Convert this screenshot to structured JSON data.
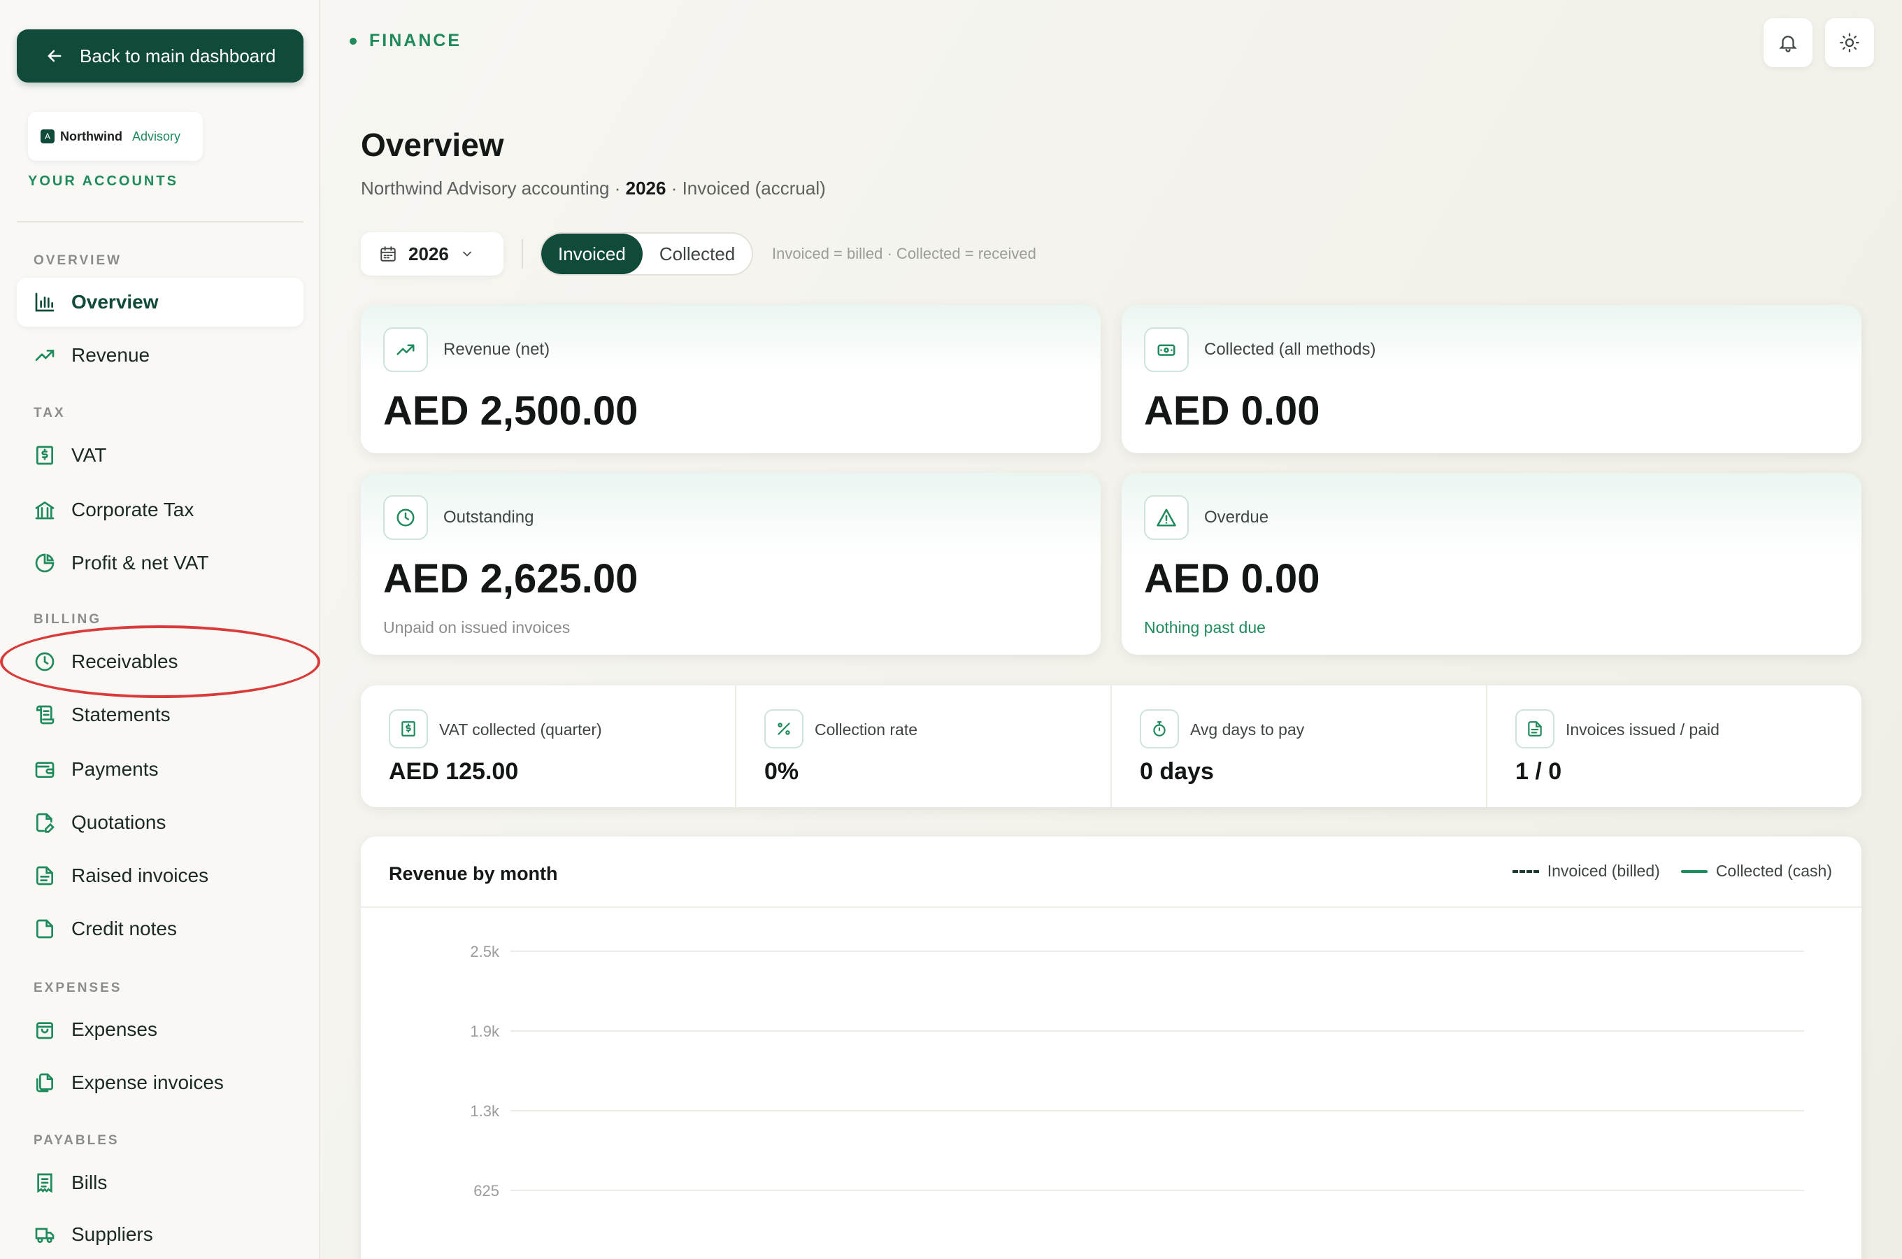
{
  "sidebar": {
    "back_label": "Back to main dashboard",
    "logo": {
      "mark": "A",
      "name": "Northwind",
      "sub": "Advisory"
    },
    "accounts_label": "YOUR ACCOUNTS",
    "sections": {
      "overview": "OVERVIEW",
      "tax": "TAX",
      "billing": "BILLING",
      "expenses": "EXPENSES",
      "payables": "PAYABLES"
    },
    "items": {
      "overview": "Overview",
      "revenue": "Revenue",
      "vat": "VAT",
      "corporate_tax": "Corporate Tax",
      "profit_vat": "Profit & net VAT",
      "receivables": "Receivables",
      "statements": "Statements",
      "payments": "Payments",
      "quotations": "Quotations",
      "raised_invoices": "Raised invoices",
      "credit_notes": "Credit notes",
      "expenses": "Expenses",
      "expense_invoices": "Expense invoices",
      "bills": "Bills",
      "suppliers": "Suppliers"
    },
    "active": "overview",
    "highlighted": "receivables"
  },
  "header": {
    "breadcrumb": "FINANCE",
    "title": "Overview",
    "subtitle_prefix": "Northwind Advisory accounting · ",
    "subtitle_year": "2026",
    "subtitle_suffix": " · Invoiced (accrual)"
  },
  "controls": {
    "year": "2026",
    "toggle_invoiced": "Invoiced",
    "toggle_collected": "Collected",
    "toggle_selected": "Invoiced",
    "hint": "Invoiced = billed · Collected = received"
  },
  "cards": {
    "revenue": {
      "label": "Revenue (net)",
      "value": "AED 2,500.00",
      "icon": "trend-up-icon"
    },
    "collected": {
      "label": "Collected (all methods)",
      "value": "AED 0.00",
      "icon": "cash-icon"
    },
    "outstanding": {
      "label": "Outstanding",
      "value": "AED 2,625.00",
      "note": "Unpaid on issued invoices",
      "icon": "clock-icon"
    },
    "overdue": {
      "label": "Overdue",
      "value": "AED 0.00",
      "note": "Nothing past due",
      "icon": "warning-icon"
    }
  },
  "stats": {
    "vat": {
      "label": "VAT collected (quarter)",
      "value": "AED 125.00"
    },
    "rate": {
      "label": "Collection rate",
      "value": "0%"
    },
    "days": {
      "label": "Avg days to pay",
      "value": "0 days"
    },
    "invoices": {
      "label": "Invoices issued / paid",
      "value": "1 / 0"
    }
  },
  "colors": {
    "brand": "#0f4a3a",
    "accent": "#1f8a5b",
    "highlight": "#d93a3a"
  },
  "chart_data": {
    "type": "line",
    "title": "Revenue by month",
    "series": [
      {
        "name": "Invoiced (billed)",
        "style": "dashed"
      },
      {
        "name": "Collected (cash)",
        "style": "solid"
      }
    ],
    "y_ticks": [
      "2.5k",
      "1.9k",
      "1.3k",
      "625"
    ],
    "grid": true,
    "legend": "top-right"
  }
}
